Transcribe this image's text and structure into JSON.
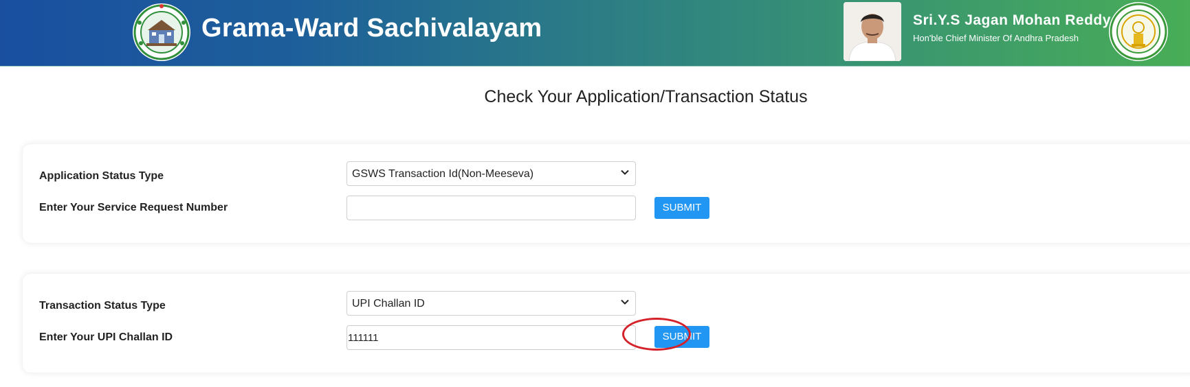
{
  "header": {
    "app_title": "Grama-Ward Sachivalayam",
    "cm_name": "Sri.Y.S Jagan Mohan Reddy",
    "cm_role": "Hon'ble Chief Minister Of Andhra Pradesh",
    "left_logo_icon": "grama-ward-sachivalayam-logo",
    "right_emblem_icon": "andhra-pradesh-emblem",
    "gradient_colors": [
      "#1a4fa0",
      "#2c7d85",
      "#48ad56"
    ]
  },
  "main": {
    "page_title": "Check Your Application/Transaction Status",
    "application_card": {
      "type_label": "Application Status Type",
      "type_selected": "GSWS Transaction Id(Non-Meeseva)",
      "request_label": "Enter Your Service Request Number",
      "request_value": "",
      "submit_label": "SUBMIT"
    },
    "transaction_card": {
      "type_label": "Transaction Status Type",
      "type_selected": "UPI Challan ID",
      "challan_label": "Enter Your UPI Challan ID",
      "challan_value": "111111",
      "submit_label": "SUBMIT"
    },
    "accent_color": "#2196f3",
    "highlight_color": "#d5222a"
  }
}
